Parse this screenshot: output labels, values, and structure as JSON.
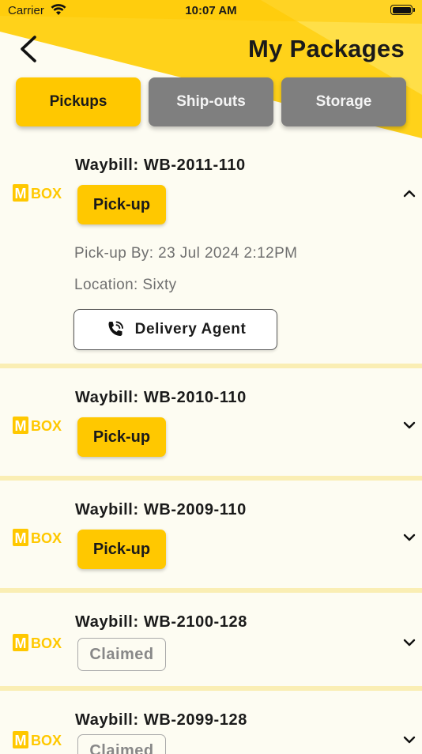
{
  "status_bar": {
    "carrier": "Carrier",
    "time": "10:07 AM"
  },
  "header": {
    "title": "My Packages"
  },
  "tabs": [
    {
      "label": "Pickups",
      "active": true
    },
    {
      "label": "Ship-outs",
      "active": false
    },
    {
      "label": "Storage",
      "active": false
    }
  ],
  "brand": {
    "logo_text": "BOX",
    "logo_mark": "M",
    "accent": "#ffc800"
  },
  "packages": [
    {
      "waybill": "Waybill: WB-2011-110",
      "status": "Pick-up",
      "expanded": true,
      "pickup_by": "Pick-up By: 23 Jul 2024 2:12PM",
      "location": "Location: Sixty",
      "action_label": "Delivery Agent"
    },
    {
      "waybill": "Waybill: WB-2010-110",
      "status": "Pick-up",
      "expanded": false
    },
    {
      "waybill": "Waybill: WB-2009-110",
      "status": "Pick-up",
      "expanded": false
    },
    {
      "waybill": "Waybill: WB-2100-128",
      "status": "Claimed",
      "expanded": false
    },
    {
      "waybill": "Waybill: WB-2099-128",
      "status": "Claimed",
      "expanded": false
    }
  ]
}
